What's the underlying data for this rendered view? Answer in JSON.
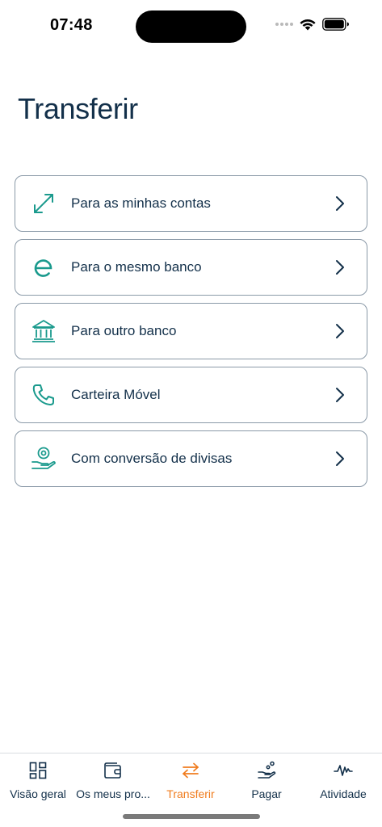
{
  "status_bar": {
    "time": "07:48"
  },
  "page": {
    "title": "Transferir"
  },
  "options": [
    {
      "label": "Para as minhas contas",
      "icon": "arrows-expand-icon"
    },
    {
      "label": "Para o mesmo banco",
      "icon": "bank-logo-e-icon"
    },
    {
      "label": "Para outro banco",
      "icon": "bank-building-icon"
    },
    {
      "label": "Carteira Móvel",
      "icon": "phone-icon"
    },
    {
      "label": "Com conversão de divisas",
      "icon": "currency-hand-icon"
    }
  ],
  "tab_bar": {
    "active": "Transferir",
    "tabs": [
      {
        "label": "Visão geral",
        "icon": "grid-icon"
      },
      {
        "label": "Os meus pro...",
        "icon": "wallet-icon"
      },
      {
        "label": "Transferir",
        "icon": "transfer-arrows-icon"
      },
      {
        "label": "Pagar",
        "icon": "pay-icon"
      },
      {
        "label": "Atividade",
        "icon": "activity-icon"
      }
    ]
  },
  "colors": {
    "primary_text": "#13304a",
    "accent_teal": "#1a9a8d",
    "accent_orange": "#f07c1e",
    "border": "#8b9aa8"
  }
}
